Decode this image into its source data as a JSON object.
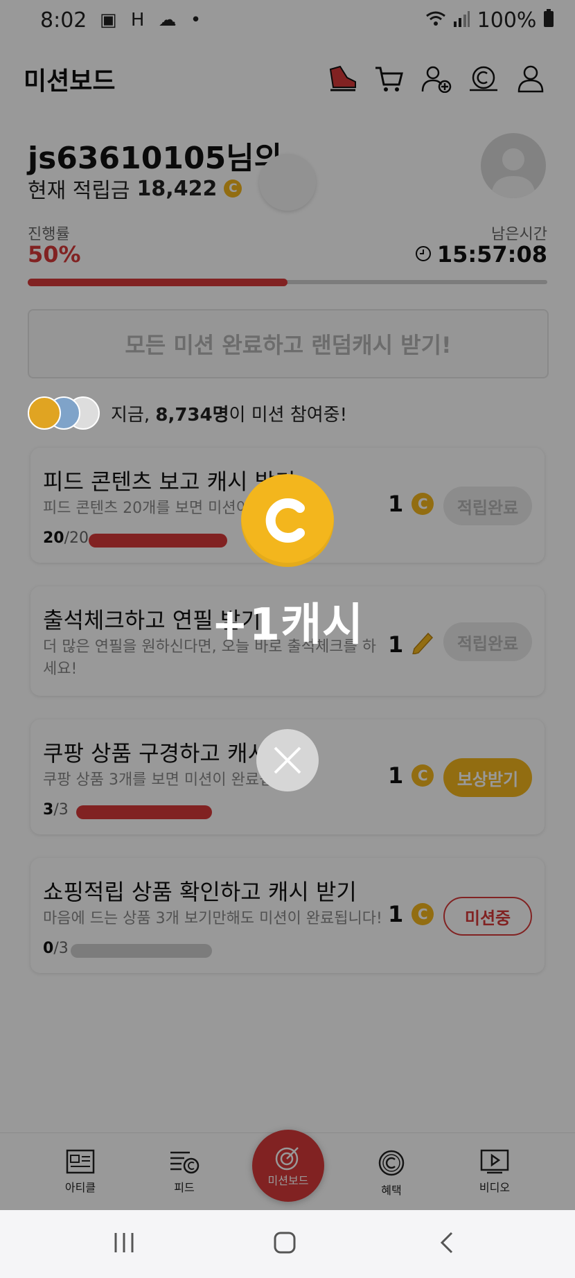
{
  "status_bar": {
    "time": "8:02",
    "left_icons": "▣ H ☁ •",
    "battery": "100%"
  },
  "header": {
    "title": "미션보드"
  },
  "user": {
    "name_line": "js63610105님의",
    "balance_label": "현재 적립금",
    "balance_value": "18,422",
    "coin_symbol": "C"
  },
  "progress": {
    "label": "진행률",
    "percent_text": "50%",
    "percent_value": 0.5,
    "remain_label": "남은시간",
    "remain_time": "15:57:08"
  },
  "all_complete_button": "모든 미션 완료하고 랜덤캐시 받기!",
  "participants": {
    "prefix": "지금, ",
    "count": "8,734명",
    "suffix": "이 미션 참여중!"
  },
  "missions": [
    {
      "title": "피드 콘텐츠 보고 캐시 받기",
      "desc": "피드 콘텐츠 20개를 보면 미션이",
      "count_done": "20",
      "count_total": "/20",
      "progress": 1.0,
      "reward": "1",
      "reward_icon": "coin-icon",
      "action": "적립완료"
    },
    {
      "title": "출석체크하고 연필 받기",
      "desc": "더 많은 연필을 원하신다면, 오늘 바로 출석체크를 하세요!",
      "reward": "1",
      "reward_icon": "pencil-icon",
      "action": "적립완료"
    },
    {
      "title": "쿠팡 상품 구경하고 캐시 받기",
      "desc": "쿠팡 상품 3개를 보면 미션이 완료됩",
      "count_done": "3",
      "count_total": "/3",
      "progress": 1.0,
      "reward": "1",
      "reward_icon": "coin-icon",
      "action": "보상받기"
    },
    {
      "title": "쇼핑적립 상품 확인하고 캐시 받기",
      "desc": "마음에 드는 상품 3개 보기만해도 미션이 완료됩니다!",
      "count_done": "0",
      "count_total": "/3",
      "progress": 0.0,
      "reward": "1",
      "reward_icon": "coin-icon",
      "action": "미션중"
    }
  ],
  "bottom_nav": {
    "article": "아티클",
    "feed": "피드",
    "mission": "미션보드",
    "benefit": "혜택",
    "video": "비디오"
  },
  "popup": {
    "coin_symbol": "C",
    "reward_text": "+1캐시"
  },
  "colors": {
    "accent_red": "#d83a3a",
    "coin_gold": "#f3b61d"
  }
}
